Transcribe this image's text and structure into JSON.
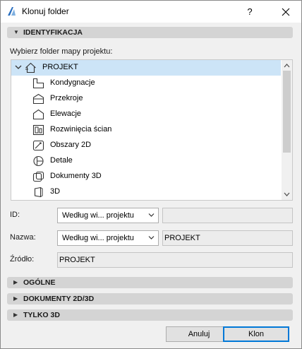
{
  "window": {
    "title": "Klonuj folder",
    "help_label": "?"
  },
  "sections": {
    "identification": "IDENTYFIKACJA",
    "general": "OGÓLNE",
    "docs": "DOKUMENTY 2D/3D",
    "only3d": "TYLKO 3D"
  },
  "tree": {
    "prompt": "Wybierz folder mapy projektu:",
    "root": {
      "label": "PROJEKT",
      "icon": "house-icon",
      "expanded": true,
      "selected": true
    },
    "items": [
      {
        "label": "Kondygnacje",
        "icon": "stories-icon"
      },
      {
        "label": "Przekroje",
        "icon": "section-icon"
      },
      {
        "label": "Elewacje",
        "icon": "elevation-icon"
      },
      {
        "label": "Rozwinięcia ścian",
        "icon": "interior-elevation-icon"
      },
      {
        "label": "Obszary 2D",
        "icon": "worksheet-icon"
      },
      {
        "label": "Detale",
        "icon": "detail-icon"
      },
      {
        "label": "Dokumenty 3D",
        "icon": "document-3d-icon"
      },
      {
        "label": "3D",
        "icon": "3d-icon"
      }
    ]
  },
  "form": {
    "id_label": "ID:",
    "id_mode": "Według wi... projektu",
    "id_value": "",
    "name_label": "Nazwa:",
    "name_mode": "Według wi... projektu",
    "name_value": "PROJEKT",
    "source_label": "Źródło:",
    "source_value": "PROJEKT"
  },
  "buttons": {
    "cancel": "Anuluj",
    "ok": "Klon"
  },
  "colors": {
    "selection": "#cce4f7",
    "accent": "#0078d7",
    "section_bar": "#d4d4d4"
  }
}
